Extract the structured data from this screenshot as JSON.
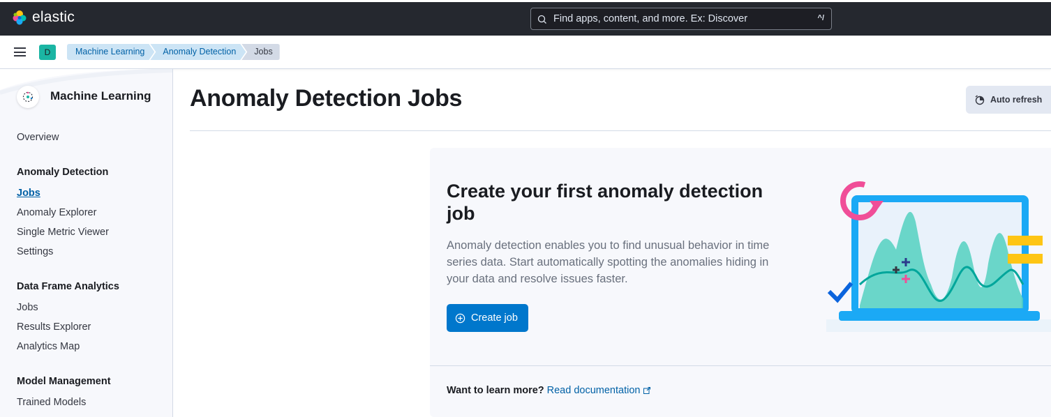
{
  "header": {
    "brand": "elastic",
    "search": {
      "placeholder": "Find apps, content, and more. Ex: Discover",
      "shortcut": "^/"
    }
  },
  "subnav": {
    "space_initial": "D",
    "breadcrumbs": [
      "Machine Learning",
      "Anomaly Detection",
      "Jobs"
    ]
  },
  "sidebar": {
    "title": "Machine Learning",
    "overview": "Overview",
    "groups": [
      {
        "label": "Anomaly Detection",
        "items": [
          "Jobs",
          "Anomaly Explorer",
          "Single Metric Viewer",
          "Settings"
        ]
      },
      {
        "label": "Data Frame Analytics",
        "items": [
          "Jobs",
          "Results Explorer",
          "Analytics Map"
        ]
      },
      {
        "label": "Model Management",
        "items": [
          "Trained Models"
        ]
      }
    ],
    "active_item": "Jobs"
  },
  "main": {
    "title": "Anomaly Detection Jobs",
    "auto_refresh": "Auto refresh",
    "empty_prompt": {
      "title": "Create your first anomaly detection job",
      "body": "Anomaly detection enables you to find unusual behavior in time series data. Start automatically spotting the anomalies hiding in your data and resolve issues faster.",
      "button": "Create job",
      "learn_label": "Want to learn more?",
      "learn_link": "Read documentation"
    }
  },
  "colors": {
    "header_bg": "#25282f",
    "primary": "#0077cc",
    "link": "#0061a6",
    "badge": "#1bb5a3"
  }
}
